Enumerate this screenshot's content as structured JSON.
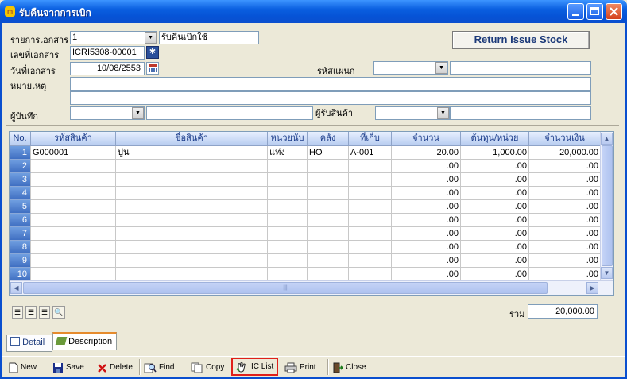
{
  "window": {
    "title": "รับคืนจากการเบิก",
    "app_icon": "m"
  },
  "header_button": "Return Issue Stock",
  "form": {
    "doc_type_label": "รายการเอกสาร",
    "doc_type_value": "1",
    "doc_type_desc": "รับคืนเบิกใช้",
    "doc_no_label": "เลขที่เอกสาร",
    "doc_no_value": "ICRI5308-00001",
    "doc_date_label": "วันที่เอกสาร",
    "doc_date_value": "10/08/2553",
    "dept_label": "รหัสแผนก",
    "dept_value": "",
    "note_label": "หมายเหตุ",
    "note_value": "",
    "recorder_label": "ผู้บันทึก",
    "recorder_value": "",
    "receiver_label": "ผู้รับสินค้า",
    "receiver_value": ""
  },
  "table": {
    "columns": [
      "No.",
      "รหัสสินค้า",
      "ชื่อสินค้า",
      "หน่วยนับ",
      "คลัง",
      "ที่เก็บ",
      "จำนวน",
      "ต้นทุน/หน่วย",
      "จำนวนเงิน"
    ],
    "rows": [
      {
        "no": "1",
        "code": "G000001",
        "name": "ปูน",
        "unit": "แท่ง",
        "wh": "HO",
        "loc": "A-001",
        "qty": "20.00",
        "cost": "1,000.00",
        "amount": "20,000.00"
      },
      {
        "no": "2",
        "code": "",
        "name": "",
        "unit": "",
        "wh": "",
        "loc": "",
        "qty": ".00",
        "cost": ".00",
        "amount": ".00"
      },
      {
        "no": "3",
        "code": "",
        "name": "",
        "unit": "",
        "wh": "",
        "loc": "",
        "qty": ".00",
        "cost": ".00",
        "amount": ".00"
      },
      {
        "no": "4",
        "code": "",
        "name": "",
        "unit": "",
        "wh": "",
        "loc": "",
        "qty": ".00",
        "cost": ".00",
        "amount": ".00"
      },
      {
        "no": "5",
        "code": "",
        "name": "",
        "unit": "",
        "wh": "",
        "loc": "",
        "qty": ".00",
        "cost": ".00",
        "amount": ".00"
      },
      {
        "no": "6",
        "code": "",
        "name": "",
        "unit": "",
        "wh": "",
        "loc": "",
        "qty": ".00",
        "cost": ".00",
        "amount": ".00"
      },
      {
        "no": "7",
        "code": "",
        "name": "",
        "unit": "",
        "wh": "",
        "loc": "",
        "qty": ".00",
        "cost": ".00",
        "amount": ".00"
      },
      {
        "no": "8",
        "code": "",
        "name": "",
        "unit": "",
        "wh": "",
        "loc": "",
        "qty": ".00",
        "cost": ".00",
        "amount": ".00"
      },
      {
        "no": "9",
        "code": "",
        "name": "",
        "unit": "",
        "wh": "",
        "loc": "",
        "qty": ".00",
        "cost": ".00",
        "amount": ".00"
      },
      {
        "no": "10",
        "code": "",
        "name": "",
        "unit": "",
        "wh": "",
        "loc": "",
        "qty": ".00",
        "cost": ".00",
        "amount": ".00"
      }
    ]
  },
  "total": {
    "label": "รวม",
    "value": "20,000.00"
  },
  "tabs": [
    {
      "label": "Detail"
    },
    {
      "label": "Description"
    }
  ],
  "toolbar": {
    "new": "New",
    "save": "Save",
    "delete": "Delete",
    "find": "Find",
    "copy": "Copy",
    "ic_list": "IC List",
    "print": "Print",
    "close": "Close"
  },
  "colors": {
    "titlebar": "#0a5fe0",
    "highlight_border": "#e0201a",
    "grid_header_text": "#1b3c8a"
  }
}
